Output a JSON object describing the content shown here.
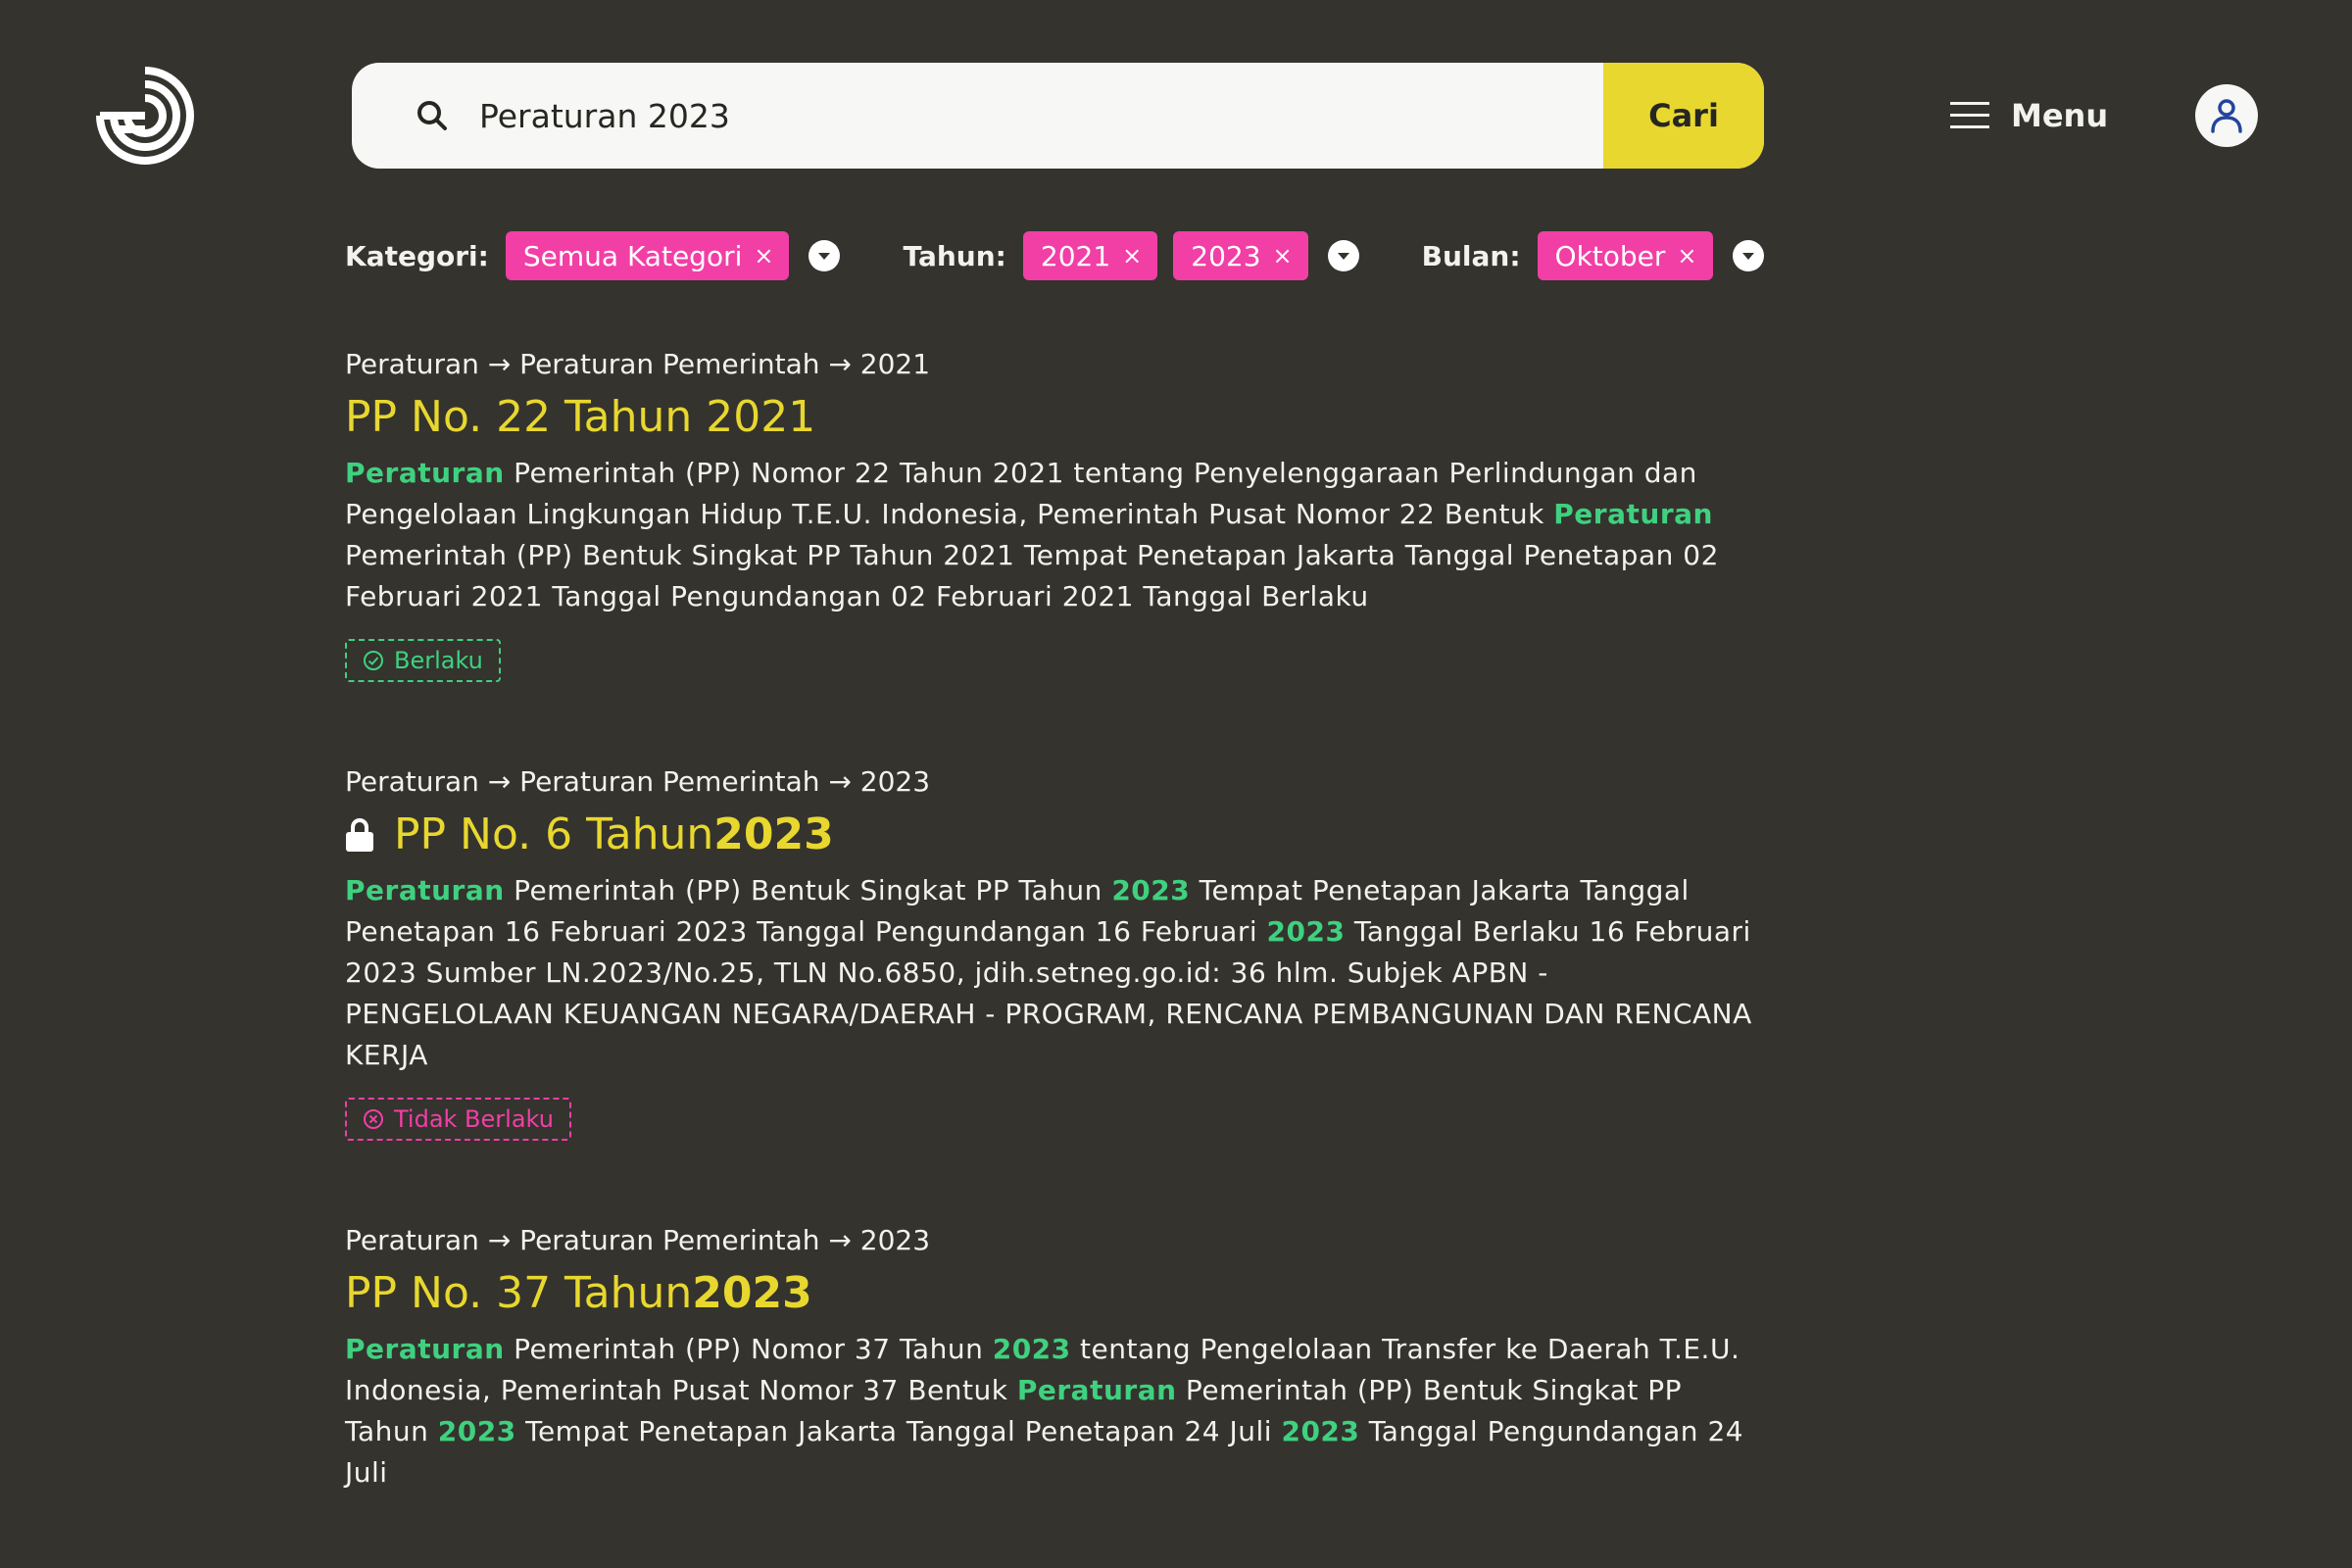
{
  "header": {
    "logo_icon": "concentric-arcs-logo",
    "search_value": "Peraturan 2023",
    "search_button": "Cari",
    "menu_label": "Menu",
    "user_icon": "user-icon"
  },
  "filters": {
    "kategori": {
      "label": "Kategori:",
      "chips": [
        "Semua Kategori"
      ]
    },
    "tahun": {
      "label": "Tahun:",
      "chips": [
        "2021",
        "2023"
      ]
    },
    "bulan": {
      "label": "Bulan:",
      "chips": [
        "Oktober"
      ]
    }
  },
  "results": [
    {
      "breadcrumb": "Peraturan → Peraturan Pemerintah → 2021",
      "title_a": "PP No. 22 Tahun 2021",
      "title_b": "",
      "locked": false,
      "snippet": [
        {
          "t": "Peraturan",
          "h": true
        },
        {
          "t": " Pemerintah (PP) Nomor 22 Tahun 2021 tentang Penyelenggaraan Perlindungan dan Pengelolaan Lingkungan Hidup T.E.U. Indonesia, Pemerintah Pusat Nomor 22 Bentuk "
        },
        {
          "t": "Peraturan",
          "h": true
        },
        {
          "t": " Pemerintah (PP) Bentuk Singkat PP Tahun 2021 Tempat Penetapan Jakarta Tanggal Penetapan 02 Februari 2021 Tanggal Pengundangan 02 Februari 2021 Tanggal Berlaku"
        }
      ],
      "status": "Berlaku",
      "status_type": "ok"
    },
    {
      "breadcrumb": "Peraturan → Peraturan Pemerintah → 2023",
      "title_a": "PP No. 6 Tahun ",
      "title_b": "2023",
      "locked": true,
      "snippet": [
        {
          "t": "Peraturan",
          "h": true
        },
        {
          "t": " Pemerintah (PP) Bentuk Singkat PP Tahun "
        },
        {
          "t": "2023",
          "h": true
        },
        {
          "t": " Tempat Penetapan Jakarta Tanggal Penetapan 16 Februari 2023 Tanggal Pengundangan 16 Februari "
        },
        {
          "t": "2023",
          "h": true
        },
        {
          "t": " Tanggal Berlaku 16 Februari 2023 Sumber LN.2023/No.25, TLN No.6850, jdih.setneg.go.id: 36 hlm. Subjek APBN - PENGELOLAAN KEUANGAN NEGARA/DAERAH - PROGRAM, RENCANA PEMBANGUNAN DAN RENCANA KERJA"
        }
      ],
      "status": "Tidak Berlaku",
      "status_type": "no"
    },
    {
      "breadcrumb": "Peraturan → Peraturan Pemerintah → 2023",
      "title_a": "PP No. 37 Tahun ",
      "title_b": "2023",
      "locked": false,
      "snippet": [
        {
          "t": "Peraturan",
          "h": true
        },
        {
          "t": " Pemerintah (PP) Nomor 37 Tahun "
        },
        {
          "t": "2023",
          "h": true
        },
        {
          "t": " tentang Pengelolaan Transfer ke Daerah T.E.U. Indonesia, Pemerintah Pusat Nomor 37 Bentuk "
        },
        {
          "t": "Peraturan",
          "h": true
        },
        {
          "t": " Pemerintah (PP) Bentuk Singkat PP Tahun "
        },
        {
          "t": "2023",
          "h": true
        },
        {
          "t": " Tempat Penetapan Jakarta Tanggal Penetapan 24 Juli "
        },
        {
          "t": "2023",
          "h": true
        },
        {
          "t": " Tanggal Pengundangan 24 Juli"
        }
      ],
      "status": "",
      "status_type": ""
    }
  ],
  "colors": {
    "background": "#34332e",
    "accent_yellow": "#e8d72e",
    "chip_pink": "#f13fa6",
    "highlight_green": "#3fd17f"
  }
}
